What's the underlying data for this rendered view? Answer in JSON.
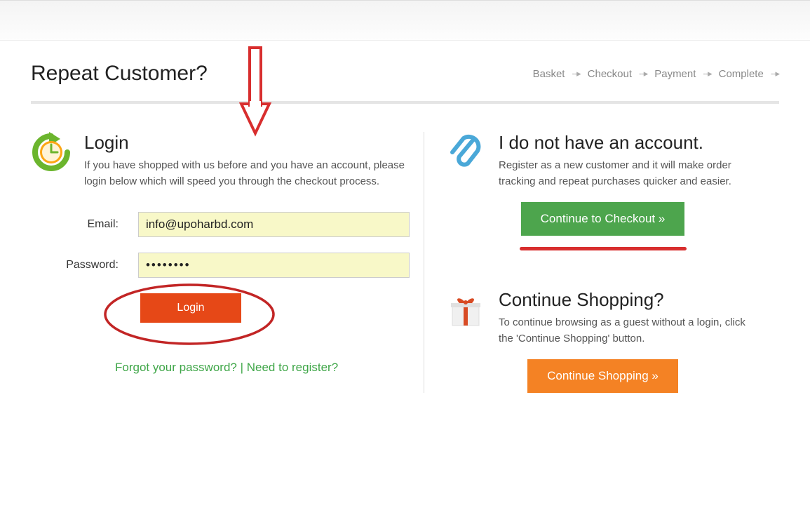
{
  "page_title": "Repeat Customer?",
  "breadcrumb": {
    "steps": [
      "Basket",
      "Checkout",
      "Payment",
      "Complete"
    ]
  },
  "login_section": {
    "title": "Login",
    "desc": "If you have shopped with us before and you have an account, please login below which will speed you through the checkout process.",
    "email_label": "Email:",
    "email_value": "info@upoharbd.com",
    "password_label": "Password:",
    "password_value": "········",
    "login_button": "Login",
    "forgot_link": "Forgot your password?",
    "register_link": "Need to register?",
    "separator": " | "
  },
  "no_account_section": {
    "title": "I do not have an account.",
    "desc": "Register as a new customer and it will make order tracking and repeat purchases quicker and easier.",
    "button": "Continue to Checkout »"
  },
  "continue_shopping_section": {
    "title": "Continue Shopping?",
    "desc": "To continue browsing as a guest without a login, click the 'Continue Shopping' button.",
    "button": "Continue Shopping »"
  }
}
